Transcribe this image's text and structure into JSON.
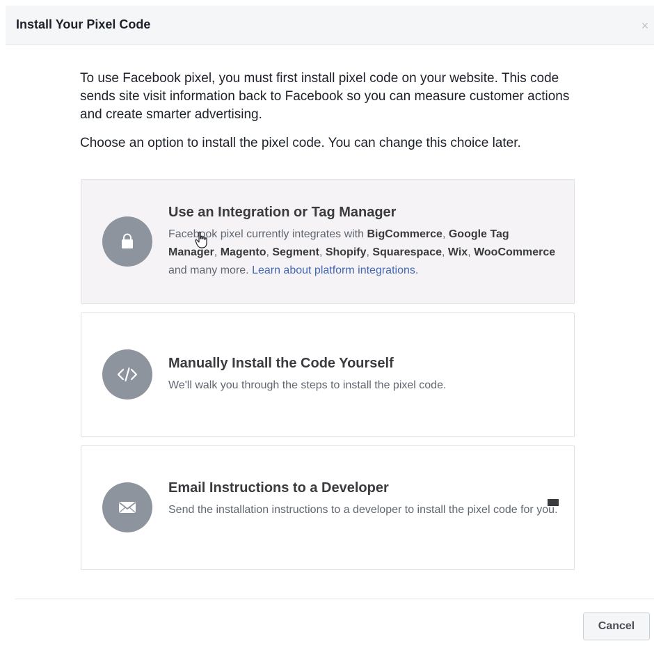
{
  "dialog": {
    "title": "Install Your Pixel Code",
    "close_glyph": "×"
  },
  "intro": {
    "paragraph1": "To use Facebook pixel, you must first install pixel code on your website. This code sends site visit information back to Facebook so you can measure customer actions and create smarter advertising.",
    "paragraph2": "Choose an option to install the pixel code. You can change this choice later."
  },
  "options": [
    {
      "title": "Use an Integration or Tag Manager",
      "icon": "shopping-bag-icon",
      "selected": true,
      "desc_prefix": "Facebook pixel currently integrates with ",
      "platforms": [
        "BigCommerce",
        "Google Tag Manager",
        "Magento",
        "Segment",
        "Shopify",
        "Squarespace",
        "Wix",
        "WooCommerce"
      ],
      "sep1": ", ",
      "desc_suffix": " and many more. ",
      "link": "Learn about platform integrations."
    },
    {
      "title": "Manually Install the Code Yourself",
      "icon": "code-icon",
      "selected": false,
      "desc": "We'll walk you through the steps to install the pixel code."
    },
    {
      "title": "Email Instructions to a Developer",
      "icon": "envelope-icon",
      "selected": false,
      "desc": "Send the installation instructions to a developer to install the pixel code for you."
    }
  ],
  "footer": {
    "cancel_label": "Cancel"
  },
  "colors": {
    "icon_circle": "#8d949e",
    "link": "#4267b2",
    "selected_bg": "#f6f3f6"
  }
}
